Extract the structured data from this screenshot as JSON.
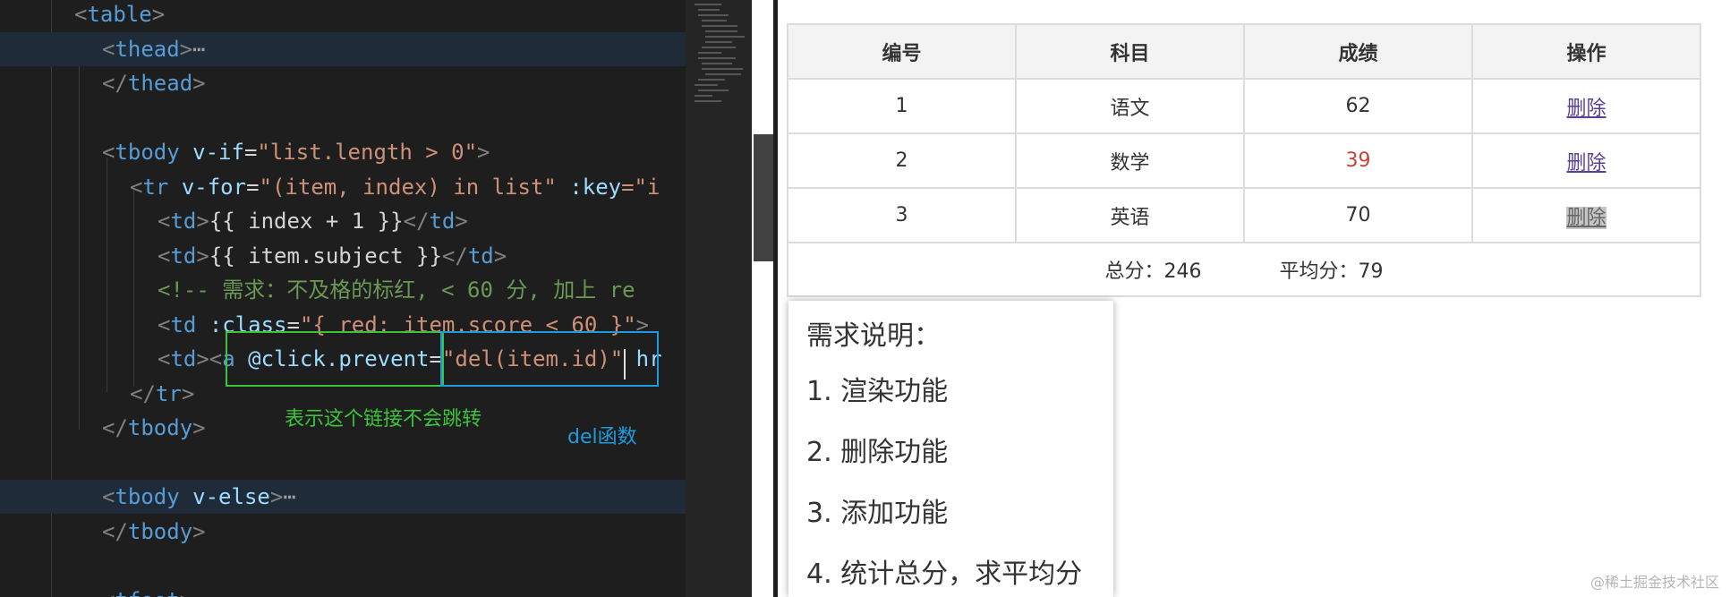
{
  "editor": {
    "lines": [
      {
        "key": "l0",
        "segments": [
          {
            "t": "<",
            "c": "tag-bracket"
          },
          {
            "t": "table",
            "c": "tag"
          },
          {
            "t": ">",
            "c": "tag-bracket"
          }
        ]
      },
      {
        "key": "l1",
        "segments": [
          {
            "t": "<",
            "c": "tag-bracket"
          },
          {
            "t": "thead",
            "c": "tag"
          },
          {
            "t": ">",
            "c": "tag-bracket"
          },
          {
            "t": "⋯",
            "c": "fold"
          }
        ]
      },
      {
        "key": "l2",
        "segments": [
          {
            "t": "</",
            "c": "tag-bracket"
          },
          {
            "t": "thead",
            "c": "tag"
          },
          {
            "t": ">",
            "c": "tag-bracket"
          }
        ]
      },
      {
        "key": "l3",
        "segments": []
      },
      {
        "key": "l4",
        "segments": [
          {
            "t": "<",
            "c": "tag-bracket"
          },
          {
            "t": "tbody ",
            "c": "tag"
          },
          {
            "t": "v-if",
            "c": "attr"
          },
          {
            "t": "=",
            "c": "punct"
          },
          {
            "t": "\"list.length > 0\"",
            "c": "str"
          },
          {
            "t": ">",
            "c": "tag-bracket"
          }
        ]
      },
      {
        "key": "l5",
        "segments": [
          {
            "t": "<",
            "c": "tag-bracket"
          },
          {
            "t": "tr ",
            "c": "tag"
          },
          {
            "t": "v-for",
            "c": "attr"
          },
          {
            "t": "=",
            "c": "punct"
          },
          {
            "t": "\"(item, index) in list\"",
            "c": "str"
          },
          {
            "t": " ",
            "c": "punct"
          },
          {
            "t": ":key",
            "c": "attr"
          },
          {
            "t": "=\"i",
            "c": "str"
          }
        ]
      },
      {
        "key": "l6",
        "segments": [
          {
            "t": "<",
            "c": "tag-bracket"
          },
          {
            "t": "td",
            "c": "tag"
          },
          {
            "t": ">",
            "c": "tag-bracket"
          },
          {
            "t": "{{ index + 1 }}",
            "c": "punct"
          },
          {
            "t": "</",
            "c": "tag-bracket"
          },
          {
            "t": "td",
            "c": "tag"
          },
          {
            "t": ">",
            "c": "tag-bracket"
          }
        ]
      },
      {
        "key": "l7",
        "segments": [
          {
            "t": "<",
            "c": "tag-bracket"
          },
          {
            "t": "td",
            "c": "tag"
          },
          {
            "t": ">",
            "c": "tag-bracket"
          },
          {
            "t": "{{ item.subject }}",
            "c": "punct"
          },
          {
            "t": "</",
            "c": "tag-bracket"
          },
          {
            "t": "td",
            "c": "tag"
          },
          {
            "t": ">",
            "c": "tag-bracket"
          }
        ]
      },
      {
        "key": "l8",
        "segments": [
          {
            "t": "<!-- 需求：不及格的标红, < 60 分, 加上 re",
            "c": "cmt"
          }
        ]
      },
      {
        "key": "l9",
        "segments": [
          {
            "t": "<",
            "c": "tag-bracket"
          },
          {
            "t": "td ",
            "c": "tag"
          },
          {
            "t": ":class",
            "c": "attr"
          },
          {
            "t": "=",
            "c": "punct"
          },
          {
            "t": "\"{ red: item.score < 60 }\"",
            "c": "str"
          },
          {
            "t": ">",
            "c": "tag-bracket"
          }
        ]
      },
      {
        "key": "l10",
        "segments": [
          {
            "t": "<",
            "c": "tag-bracket"
          },
          {
            "t": "td",
            "c": "tag"
          },
          {
            "t": "><",
            "c": "tag-bracket"
          },
          {
            "t": "a ",
            "c": "tag"
          },
          {
            "t": "@click.prevent",
            "c": "attr"
          },
          {
            "t": "=",
            "c": "punct"
          },
          {
            "t": "\"del(item.id)\"",
            "c": "str"
          },
          {
            "t": " hr",
            "c": "attr"
          }
        ]
      },
      {
        "key": "l11",
        "segments": [
          {
            "t": "</",
            "c": "tag-bracket"
          },
          {
            "t": "tr",
            "c": "tag"
          },
          {
            "t": ">",
            "c": "tag-bracket"
          }
        ]
      },
      {
        "key": "l12",
        "segments": [
          {
            "t": "</",
            "c": "tag-bracket"
          },
          {
            "t": "tbody",
            "c": "tag"
          },
          {
            "t": ">",
            "c": "tag-bracket"
          }
        ]
      },
      {
        "key": "l13",
        "segments": []
      },
      {
        "key": "l14",
        "segments": [
          {
            "t": "<",
            "c": "tag-bracket"
          },
          {
            "t": "tbody ",
            "c": "tag"
          },
          {
            "t": "v-else",
            "c": "attr"
          },
          {
            "t": ">",
            "c": "tag-bracket"
          },
          {
            "t": "⋯",
            "c": "fold"
          }
        ]
      },
      {
        "key": "l15",
        "segments": [
          {
            "t": "</",
            "c": "tag-bracket"
          },
          {
            "t": "tbody",
            "c": "tag"
          },
          {
            "t": ">",
            "c": "tag-bracket"
          }
        ]
      },
      {
        "key": "l16",
        "segments": []
      },
      {
        "key": "l17",
        "segments": [
          {
            "t": "<",
            "c": "tag-bracket"
          },
          {
            "t": "tfoot",
            "c": "tag"
          },
          {
            "t": ">",
            "c": "tag-bracket"
          }
        ]
      }
    ],
    "annotations": {
      "prevent_note": "表示这个链接不会跳转",
      "del_note": "del函数",
      "green": "#3bc43b",
      "blue": "#1e9be0"
    }
  },
  "preview": {
    "table": {
      "headers": [
        "编号",
        "科目",
        "成绩",
        "操作"
      ],
      "rows": [
        {
          "id": "1",
          "subject": "语文",
          "score": "62",
          "action": "删除",
          "failing": false
        },
        {
          "id": "2",
          "subject": "数学",
          "score": "39",
          "action": "删除",
          "failing": true
        },
        {
          "id": "3",
          "subject": "英语",
          "score": "70",
          "action": "删除",
          "failing": false
        }
      ],
      "footer": {
        "total_label": "总分：246",
        "avg_label": "平均分：79"
      }
    },
    "requirements": {
      "title": "需求说明：",
      "items": [
        "1. 渲染功能",
        "2. 删除功能",
        "3. 添加功能",
        "4. 统计总分，求平均分"
      ]
    },
    "watermark": "@稀土掘金技术社区"
  }
}
